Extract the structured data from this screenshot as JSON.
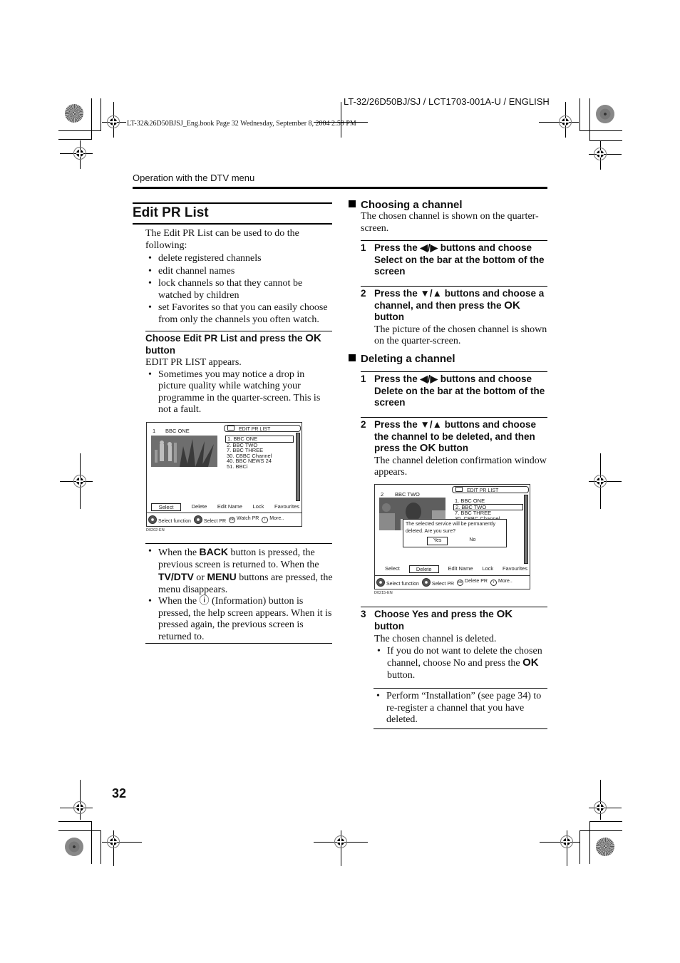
{
  "page": {
    "header_code": "LT-32/26D50BJ/SJ / LCT1703-001A-U / ENGLISH",
    "book_line": "LT-32&26D50BJSJ_Eng.book  Page 32  Wednesday, September 8, 2004  2:59 PM",
    "section_label": "Operation with the DTV menu",
    "page_number": "32"
  },
  "left": {
    "title": "Edit PR List",
    "intro": "The Edit PR List can be used to do the following:",
    "uses": [
      "delete registered channels",
      "edit channel names",
      "lock channels so that they cannot be watched by children",
      "set Favorites so that you can easily choose from only the channels you often watch."
    ],
    "step_head_pre": "Choose Edit PR List and press the ",
    "step_head_ok": "OK",
    "step_head_post": "button",
    "step_result": "EDIT PR LIST appears.",
    "step_note": "Sometimes you may notice a drop in picture quality while watching your programme in the quarter-screen. This is not a fault.",
    "notes": {
      "n1_a": "When the ",
      "n1_back": "BACK",
      "n1_b": " button is pressed, the previous screen is returned to. When the ",
      "n1_tvdtv": "TV/DTV",
      "n1_c": " or ",
      "n1_menu": "MENU",
      "n1_d": " buttons are pressed, the menu disappears.",
      "n2_a": "When the ",
      "n2_icon": "ⓘ",
      "n2_b": " (Information) button is pressed, the help screen appears. When it is pressed again, the previous screen is returned to."
    }
  },
  "screen1": {
    "channel_num": "1",
    "channel_name": "BBC ONE",
    "list_title": "EDIT PR LIST",
    "channels": [
      "1. BBC ONE",
      "2. BBC TWO",
      "7. BBC THREE",
      "30. CBBC Channel",
      "40. BBC NEWS 24",
      "51. BBCi"
    ],
    "selected_channel_index": 0,
    "functions": [
      "Select",
      "Delete",
      "Edit Name",
      "Lock",
      "Favourites"
    ],
    "selected_function": "Select",
    "help": [
      "Select function",
      "Select PR",
      "Watch PR",
      "More.."
    ],
    "figure_id": "D0202-EN"
  },
  "right": {
    "choosing": {
      "heading": "Choosing a channel",
      "desc": "The chosen channel is shown on the quarter-screen.",
      "step1_num": "1",
      "step1": "Press the ◀/▶ buttons and choose Select on the bar at the bottom of the screen",
      "step2_num": "2",
      "step2_pre": "Press the ▼/▲ buttons and choose a channel, and then press the ",
      "step2_ok": "OK",
      "step2_post": "button",
      "step2_result": "The picture of the chosen channel is shown on the quarter-screen."
    },
    "deleting": {
      "heading": "Deleting a channel",
      "step1_num": "1",
      "step1": "Press the ◀/▶ buttons and choose Delete on the bar at the bottom of the screen",
      "step2_num": "2",
      "step2_pre": "Press the ▼/▲ buttons and choose the channel to be deleted, and then press the ",
      "step2_ok": "OK",
      "step2_post": " button",
      "step2_result": "The channel deletion confirmation window appears.",
      "step3_num": "3",
      "step3_pre": "Choose Yes and press the ",
      "step3_ok": "OK",
      "step3_post": "button",
      "step3_result": "The chosen channel is deleted.",
      "step3_note_pre": "If you do not want to delete the chosen channel, choose No and press the ",
      "step3_note_ok": "OK",
      "step3_note_post": " button.",
      "final_note": "Perform “Installation” (see page 34) to re-register a channel that you have deleted."
    }
  },
  "screen2": {
    "channel_num": "2",
    "channel_name": "BBC TWO",
    "list_title": "EDIT PR LIST",
    "channels": [
      "1. BBC ONE",
      "2. BBC TWO",
      "7. BBC THREE",
      "30. CBBC Channel"
    ],
    "selected_channel_index": 1,
    "dialog_text": "The selected service will be permanently deleted. Are you sure?",
    "dialog_yes": "Yes",
    "dialog_no": "No",
    "functions": [
      "Select",
      "Delete",
      "Edit Name",
      "Lock",
      "Favourites"
    ],
    "selected_function": "Delete",
    "help": [
      "Select function",
      "Select PR",
      "Delete PR",
      "More.."
    ],
    "figure_id": "D0215-EN"
  }
}
